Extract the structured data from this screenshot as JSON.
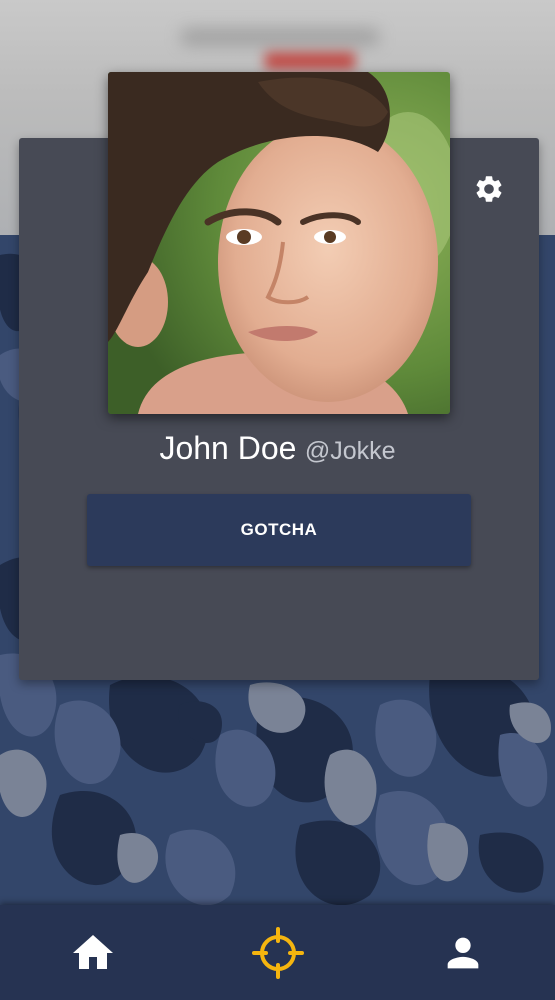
{
  "profile": {
    "name": "John Doe",
    "handle": "@Jokke",
    "photo_alt": "profile-photo"
  },
  "actions": {
    "gotcha_label": "GOTCHA"
  },
  "icons": {
    "settings": "gear-icon",
    "home": "home-icon",
    "target": "crosshair-icon",
    "profile": "person-icon"
  },
  "colors": {
    "card": "#474a55",
    "button": "#2c3a5b",
    "nav": "#263352",
    "accent_active": "#f5b50f",
    "icon": "#ffffff"
  },
  "nav": {
    "active": "target"
  }
}
